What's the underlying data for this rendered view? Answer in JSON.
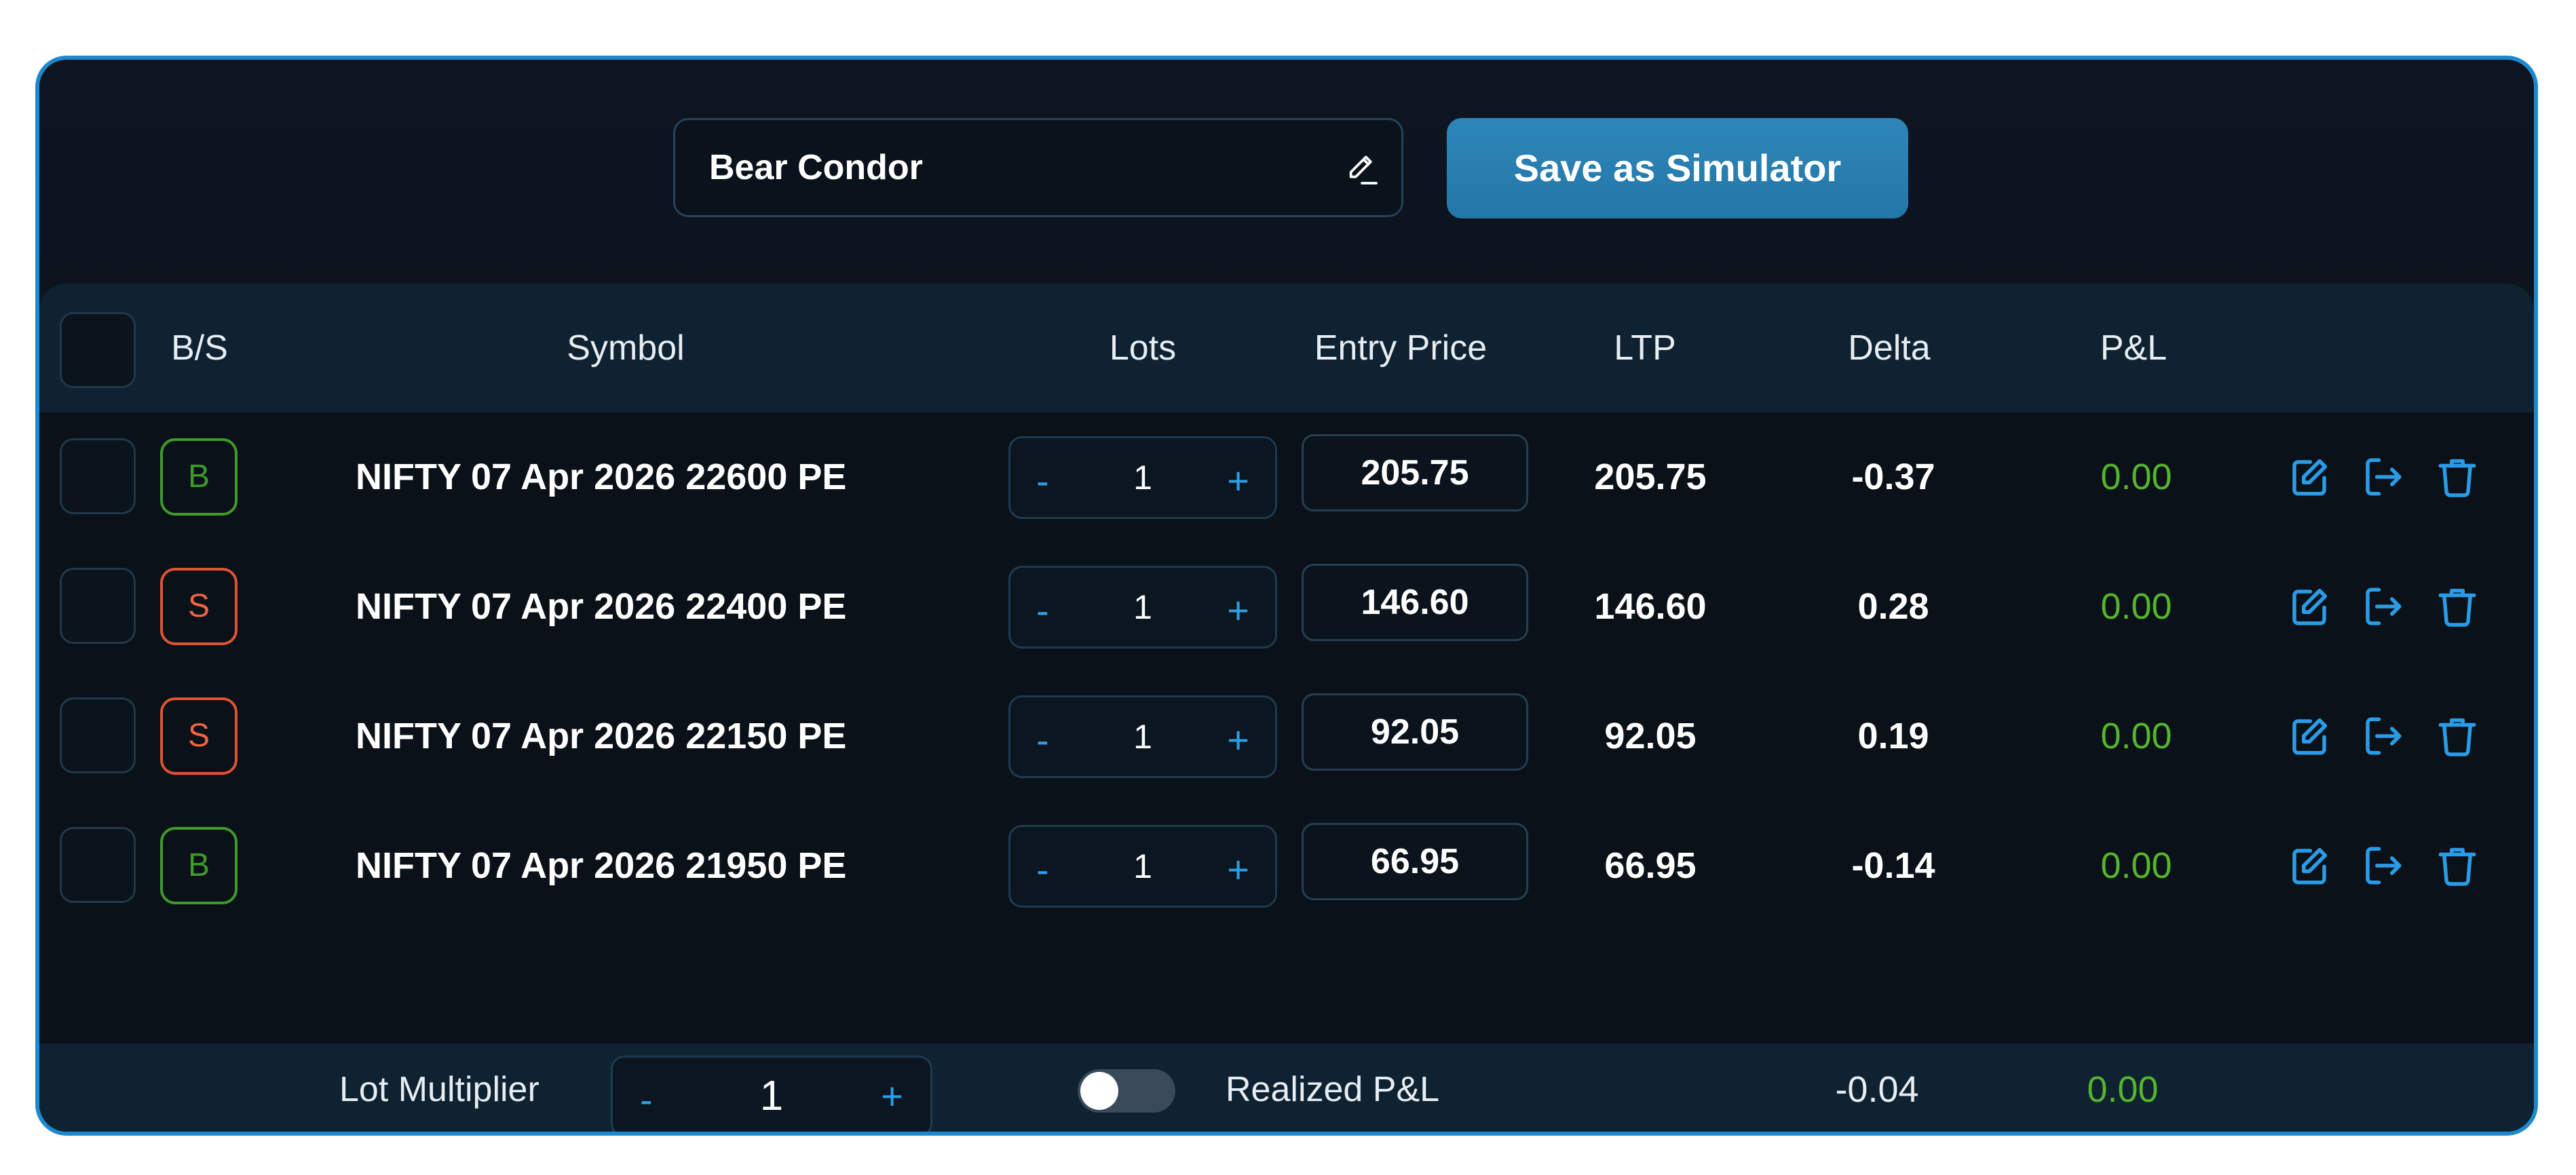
{
  "strategy": {
    "name": "Bear Condor"
  },
  "toolbar": {
    "save_label": "Save as Simulator"
  },
  "table": {
    "headers": {
      "bs": "B/S",
      "symbol": "Symbol",
      "lots": "Lots",
      "entry_price": "Entry Price",
      "ltp": "LTP",
      "delta": "Delta",
      "pnl": "P&L"
    },
    "rows": [
      {
        "side": "B",
        "symbol": "NIFTY 07 Apr 2026 22600 PE",
        "lots_minus": "-",
        "lots": "1",
        "lots_plus": "+",
        "entry_price": "205.75",
        "ltp": "205.75",
        "delta": "-0.37",
        "pnl": "0.00"
      },
      {
        "side": "S",
        "symbol": "NIFTY 07 Apr 2026 22400 PE",
        "lots_minus": "-",
        "lots": "1",
        "lots_plus": "+",
        "entry_price": "146.60",
        "ltp": "146.60",
        "delta": "0.28",
        "pnl": "0.00"
      },
      {
        "side": "S",
        "symbol": "NIFTY 07 Apr 2026 22150 PE",
        "lots_minus": "-",
        "lots": "1",
        "lots_plus": "+",
        "entry_price": "92.05",
        "ltp": "92.05",
        "delta": "0.19",
        "pnl": "0.00"
      },
      {
        "side": "B",
        "symbol": "NIFTY 07 Apr 2026 21950 PE",
        "lots_minus": "-",
        "lots": "1",
        "lots_plus": "+",
        "entry_price": "66.95",
        "ltp": "66.95",
        "delta": "-0.14",
        "pnl": "0.00"
      }
    ]
  },
  "footer": {
    "lot_multiplier_label": "Lot Multiplier",
    "lot_multiplier_minus": "-",
    "lot_multiplier_value": "1",
    "lot_multiplier_plus": "+",
    "realized_label": "Realized P&L",
    "realized_toggle_on": false,
    "total_delta": "-0.04",
    "total_pnl": "0.00"
  },
  "icons": {
    "rename": "pencil-icon",
    "edit": "edit-icon",
    "exit": "exit-icon",
    "delete": "trash-icon"
  },
  "colors": {
    "accent": "#1c89cf",
    "buy": "#3f9a2a",
    "sell": "#e05332",
    "profit": "#55b52c",
    "save_button": "#2e86b8"
  }
}
